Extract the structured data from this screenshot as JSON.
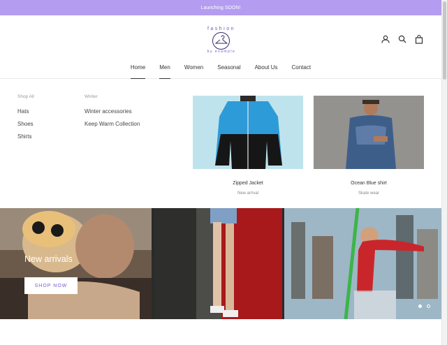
{
  "announcement": "Launching SOON!",
  "logo": {
    "top": "fashion",
    "bottom": "by example"
  },
  "header_icons": [
    "account-icon",
    "search-icon",
    "cart-bag-icon"
  ],
  "nav": [
    {
      "label": "Home",
      "active": true
    },
    {
      "label": "Men",
      "active": true
    },
    {
      "label": "Women",
      "active": false
    },
    {
      "label": "Seasonal",
      "active": false
    },
    {
      "label": "About Us",
      "active": false
    },
    {
      "label": "Contact",
      "active": false
    }
  ],
  "mega_menu": {
    "columns": [
      {
        "title": "Shop All",
        "links": [
          "Hats",
          "Shoes",
          "Shirts"
        ]
      },
      {
        "title": "Winter",
        "links": [
          "Winter accessories",
          "Keep Warm Collection"
        ]
      }
    ],
    "promos": [
      {
        "title": "Zipped Jacket",
        "subtitle": "New arrival"
      },
      {
        "title": "Ocean Blue shirt",
        "subtitle": "Skate wear"
      }
    ]
  },
  "hero": {
    "title": "New arrivals",
    "button": "SHOP NOW",
    "slide_index": 1,
    "slide_count": 2
  },
  "colors": {
    "announcement_bg": "#b49cf0",
    "accent": "#7a5ec9"
  }
}
